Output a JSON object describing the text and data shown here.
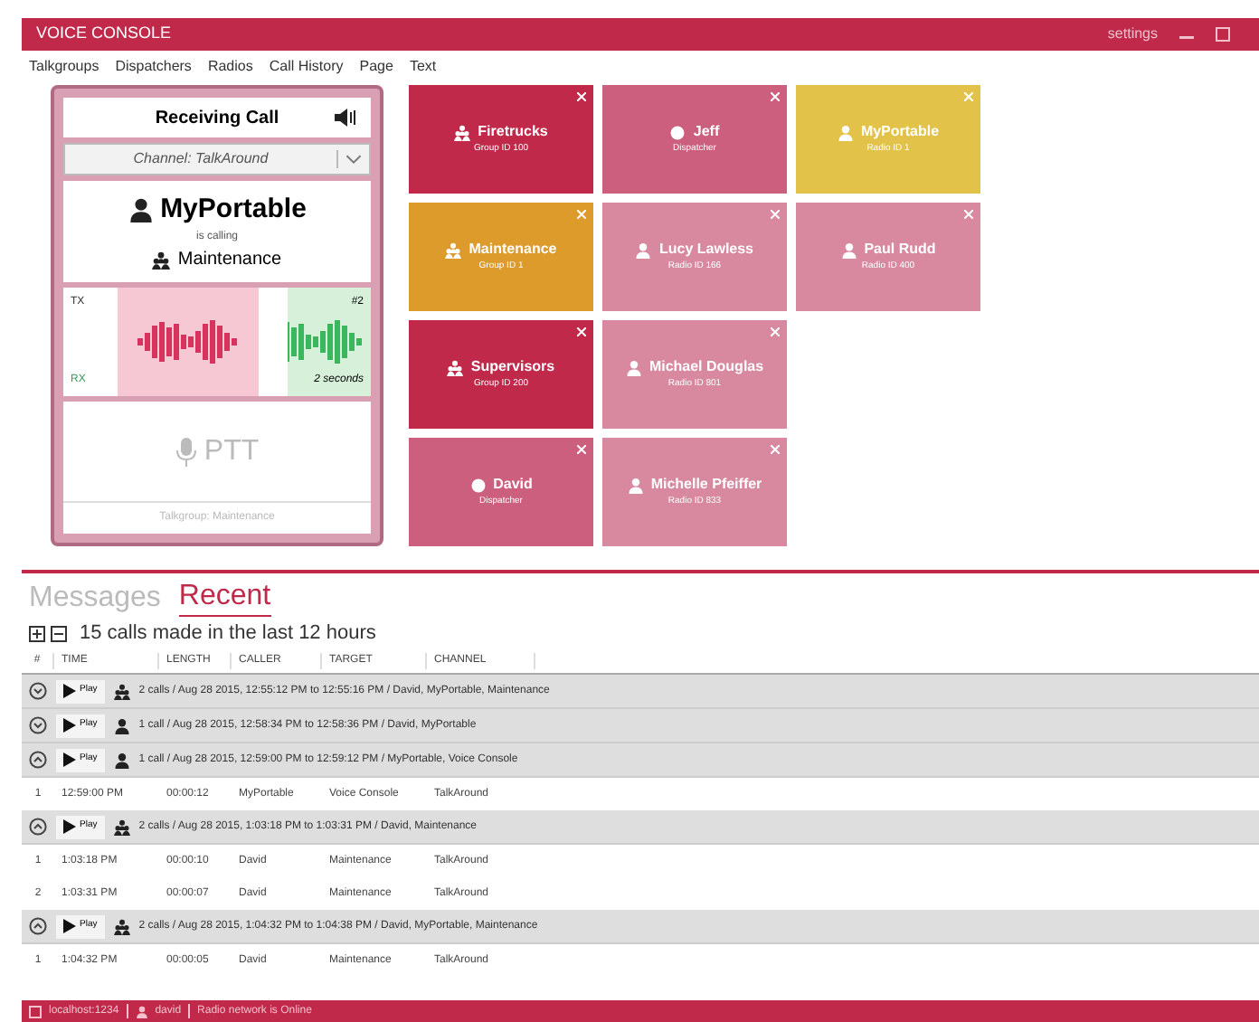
{
  "window": {
    "title": "VOICE CONSOLE",
    "settings": "settings"
  },
  "menu": [
    "Talkgroups",
    "Dispatchers",
    "Radios",
    "Call History",
    "Page",
    "Text"
  ],
  "call_card": {
    "status": "Receiving Call",
    "channel": "Channel: TalkAround",
    "caller": "MyPortable",
    "calling": "is calling",
    "target": "Maintenance",
    "tx": "TX",
    "rx": "RX",
    "count": "#2",
    "duration": "2 seconds",
    "ptt": "PTT",
    "ptt_disabled": true,
    "ptt_target": "Talkgroup: Maintenance"
  },
  "tiles": [
    {
      "kind": "group",
      "name": "Firetrucks",
      "sub": "Group ID 100",
      "color": "#c0294a"
    },
    {
      "kind": "group",
      "name": "Maintenance",
      "sub": "Group ID 1",
      "color": "#dd9b2c"
    },
    {
      "kind": "group",
      "name": "Supervisors",
      "sub": "Group ID 200",
      "color": "#c0294a"
    },
    {
      "kind": "dispatcher",
      "name": "David",
      "sub": "Dispatcher",
      "color": "#cc5f7e"
    },
    {
      "kind": "dispatcher",
      "name": "Jeff",
      "sub": "Dispatcher",
      "color": "#cc5f7e"
    },
    {
      "kind": "radio",
      "name": "Lucy Lawless",
      "sub": "Radio ID 166",
      "color": "#d8899f"
    },
    {
      "kind": "radio",
      "name": "Michael Douglas",
      "sub": "Radio ID 801",
      "color": "#d8899f"
    },
    {
      "kind": "radio",
      "name": "Michelle Pfeiffer",
      "sub": "Radio ID 833",
      "color": "#d8899f"
    },
    {
      "kind": "radio",
      "name": "MyPortable",
      "sub": "Radio ID 1",
      "color": "#e3c24a"
    },
    {
      "kind": "radio",
      "name": "Paul Rudd",
      "sub": "Radio ID 400",
      "color": "#d8899f"
    }
  ],
  "tabs": [
    {
      "label": "Messages",
      "selected": false
    },
    {
      "label": "Recent",
      "selected": true
    }
  ],
  "summary": "15 calls made in the last 12 hours",
  "columns": [
    "#",
    "TIME",
    "LENGTH",
    "CALLER",
    "TARGET",
    "CHANNEL"
  ],
  "groups": [
    {
      "kind": "group",
      "expanded": false,
      "play": "Play",
      "text": "2 calls / Aug 28 2015, 12:55:12 PM to 12:55:16 PM / David, MyPortable, Maintenance"
    },
    {
      "kind": "radio",
      "expanded": false,
      "play": "Play",
      "text": "1 call / Aug 28 2015, 12:58:34 PM to 12:58:36 PM / David, MyPortable"
    },
    {
      "kind": "radio",
      "expanded": true,
      "play": "Play",
      "text": "1 call / Aug 28 2015, 12:59:00 PM to 12:59:12 PM / MyPortable, Voice Console",
      "rows": [
        [
          "1",
          "12:59:00 PM",
          "00:00:12",
          "MyPortable",
          "Voice Console",
          "TalkAround"
        ]
      ]
    },
    {
      "kind": "group",
      "expanded": true,
      "play": "Play",
      "text": "2 calls / Aug 28 2015, 1:03:18 PM to 1:03:31 PM / David, Maintenance",
      "rows": [
        [
          "1",
          "1:03:18 PM",
          "00:00:10",
          "David",
          "Maintenance",
          "TalkAround"
        ],
        [
          "2",
          "1:03:31 PM",
          "00:00:07",
          "David",
          "Maintenance",
          "TalkAround"
        ]
      ]
    },
    {
      "kind": "group",
      "expanded": true,
      "play": "Play",
      "text": "2 calls / Aug 28 2015, 1:04:32 PM to 1:04:38 PM / David, MyPortable, Maintenance",
      "rows": [
        [
          "1",
          "1:04:32 PM",
          "00:00:05",
          "David",
          "Maintenance",
          "TalkAround"
        ]
      ]
    }
  ],
  "status_bar": [
    "localhost:1234",
    "david",
    "Radio network is Online"
  ]
}
